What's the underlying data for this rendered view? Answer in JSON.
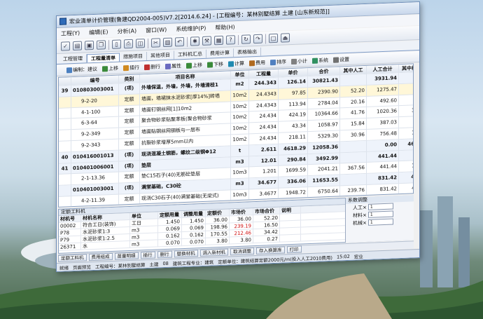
{
  "window": {
    "title": "宏业清单计价管理(鲁建QD2004-005)V7.2[2014.6.24] - [工程编号：某林别墅结算  土建 [山东新规范]]"
  },
  "menu": [
    "工程(Y)",
    "编辑(E)",
    "分析(A)",
    "窗口(W)",
    "系统维护(P)",
    "帮助(H)"
  ],
  "tabs": [
    "工程管理",
    "工程量清单",
    "措施项目",
    "其他项目",
    "工料机汇总",
    "费用计算",
    "表格输出"
  ],
  "subtoolbar": [
    "编制：建议",
    "上移",
    "插行",
    "删行",
    "属性",
    "上移",
    "下移",
    "计算",
    "费用",
    "排序",
    "小计",
    "系统",
    "设置"
  ],
  "grid": {
    "columns": [
      "编号",
      "类别",
      "项目名称",
      "单位",
      "工程量",
      "单价",
      "合价",
      "其中人工",
      "人工合计",
      "其中机"
    ],
    "rows": [
      {
        "no": "39",
        "code": "010803003001",
        "type": "(项)",
        "name": "外墙保温，外墙，外墙，外墙清桂1",
        "unit": "m2",
        "qty": "244.343",
        "price": "126.14",
        "total": "30821.43",
        "labor": "",
        "labor_total": "3931.94",
        "mach": "",
        "bold": true
      },
      {
        "no": "",
        "code": "9-2-20",
        "type": "定额",
        "name": "墙面，墙裙抹水泥砂浆[厚14%]砖墙",
        "unit": "10m2",
        "qty": "24.4343",
        "price": "97.85",
        "total": "2390.90",
        "labor": "52.20",
        "labor_total": "1275.47",
        "mach": "4"
      },
      {
        "no": "",
        "code": "4-1-100",
        "type": "定额",
        "name": "墙面钉钢丝网[1]10m2",
        "unit": "10m2",
        "qty": "24.4343",
        "price": "113.94",
        "total": "2784.04",
        "labor": "20.16",
        "labor_total": "492.60",
        "mach": "9"
      },
      {
        "no": "",
        "code": "6-3-64",
        "type": "定额",
        "name": "聚合物砂浆贴聚苯板(聚合物砂浆",
        "unit": "10m2",
        "qty": "24.434",
        "price": "424.19",
        "total": "10364.66",
        "labor": "41.76",
        "labor_total": "1020.36",
        "mach": "38"
      },
      {
        "no": "",
        "code": "9-2-349",
        "type": "定额",
        "name": "墙面贴钢丝网钢板与一层布",
        "unit": "10m2",
        "qty": "24.434",
        "price": "43.34",
        "total": "1058.97",
        "labor": "15.84",
        "labor_total": "387.03",
        "mach": "2"
      },
      {
        "no": "",
        "code": "9-2-343",
        "type": "定额",
        "name": "抗裂砂浆增厚5mm以内",
        "unit": "10m2",
        "qty": "24.434",
        "price": "218.11",
        "total": "5329.30",
        "labor": "30.96",
        "labor_total": "756.48",
        "mach": "14"
      },
      {
        "no": "40",
        "code": "010416001013",
        "type": "(项)",
        "name": "现浇混凝土钢筋，螺纹二级钢Φ12",
        "unit": "t",
        "qty": "2.611",
        "price": "4618.29",
        "total": "12058.36",
        "labor": "",
        "labor_total": "0.00",
        "mach": "461",
        "bold": true
      },
      {
        "no": "41",
        "code": "010401006001",
        "type": "(项)",
        "name": "垫层",
        "unit": "m3",
        "qty": "12.01",
        "price": "290.84",
        "total": "3492.99",
        "labor": "",
        "labor_total": "441.44",
        "mach": "",
        "bold": true
      },
      {
        "no": "",
        "code": "2-1-13.36",
        "type": "定额",
        "name": "垫C15石子(40)无筋砼垫层",
        "unit": "10m3",
        "qty": "1.201",
        "price": "1699.59",
        "total": "2041.21",
        "labor": "367.56",
        "labor_total": "441.44",
        "mach": "13"
      },
      {
        "no": "",
        "code": "010401003001",
        "type": "(项)",
        "name": "满堂基础，C30砼",
        "unit": "m3",
        "qty": "34.677",
        "price": "336.06",
        "total": "11653.55",
        "labor": "",
        "labor_total": "831.42",
        "mach": "43",
        "bold": true
      },
      {
        "no": "",
        "code": "4-2-11.39",
        "type": "定额",
        "name": "现浇C30石子(40)满堂基础(无梁式)",
        "unit": "10m3",
        "qty": "3.4677",
        "price": "1948.72",
        "total": "6750.64",
        "labor": "239.76",
        "labor_total": "831.42",
        "mach": "43"
      }
    ]
  },
  "bottom": {
    "header": "定额工料机",
    "columns": [
      "材机号",
      "材机名称",
      "单位",
      "定额用量",
      "调整用量",
      "定额价",
      "市场价",
      "市场合价",
      "说明"
    ],
    "rows": [
      [
        "00002",
        "符合工日(装饰)",
        "工日",
        "1.450",
        "1.450",
        "36.00",
        "36.00",
        "52.20",
        ""
      ],
      [
        "P78",
        "水泥砂浆1:3",
        "m3",
        "0.069",
        "0.069",
        "198.96",
        "239.19",
        "16.50",
        ""
      ],
      [
        "P79",
        "水泥砂浆1:2.5",
        "m3",
        "0.162",
        "0.162",
        "170.55",
        "212.46",
        "34.42",
        ""
      ],
      [
        "26371",
        "水",
        "m3",
        "0.070",
        "0.070",
        "3.80",
        "3.80",
        "0.27",
        ""
      ]
    ]
  },
  "side": {
    "header": "系数调整",
    "rows": [
      {
        "label": "人工×",
        "value": "1"
      },
      {
        "label": "材料×",
        "value": "1"
      },
      {
        "label": "机械×",
        "value": "1"
      }
    ]
  },
  "bottom_tabs": [
    "定额工料机",
    "费用组成",
    "苗量明细",
    "插行",
    "删行",
    "替换材机",
    "调入新材机",
    "取消调整",
    "存入换算库",
    "打印"
  ],
  "status": [
    "就绪",
    "页面预览",
    "工程编号：某林别墅结算",
    "土建",
    "08",
    "建筑工程专业：建筑",
    "定额单位：建筑结算定额2000元/m(投入人工2010费用)",
    "15:02",
    "宏业"
  ]
}
